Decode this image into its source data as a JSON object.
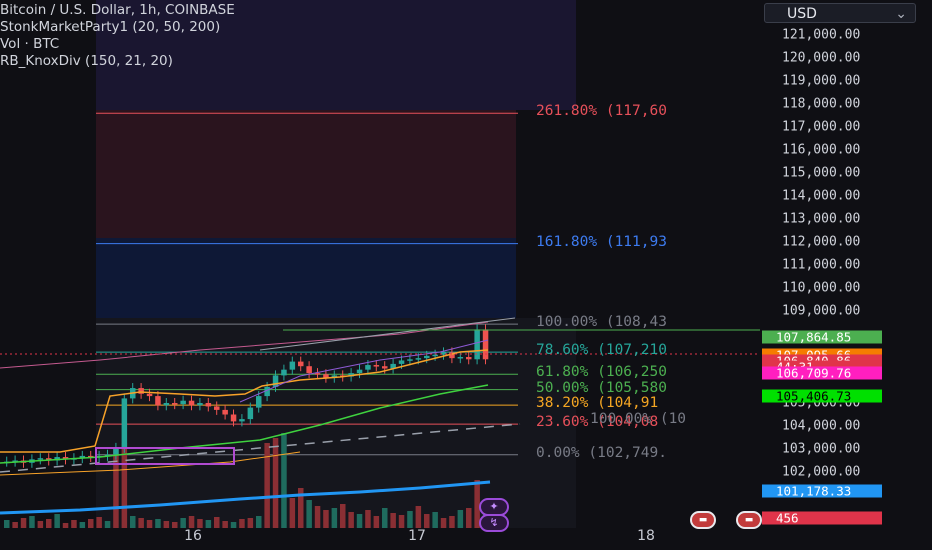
{
  "legend": {
    "symbol": "Bitcoin / U.S. Dollar, 1h, COINBASE",
    "indicator1": "StonkMarketParty1 (20, 50, 200)",
    "indicator2": "Vol · BTC",
    "indicator3": "RB_KnoxDiv (150, 21, 20)"
  },
  "currency": "USD",
  "price_axis": {
    "ticks": [
      "121,000.00",
      "120,000.00",
      "119,000.00",
      "118,000.00",
      "117,000.00",
      "116,000.00",
      "115,000.00",
      "114,000.00",
      "113,000.00",
      "112,000.00",
      "111,000.00",
      "110,000.00",
      "109,000.00",
      "105,000.00",
      "104,000.00",
      "103,000.00",
      "102,000.00",
      ".000.00"
    ],
    "tick_values": [
      121000,
      120000,
      119000,
      118000,
      117000,
      116000,
      115000,
      114000,
      113000,
      112000,
      111000,
      110000,
      109000,
      105000,
      104000,
      103000,
      102000,
      100000
    ]
  },
  "price_badges": [
    {
      "text": "107,864.85",
      "value": 107864.85,
      "bg": "#4caf50",
      "fg": "#ffffff"
    },
    {
      "text": "107,095.66",
      "value": 107095.66,
      "bg": "#f57c00",
      "fg": "#ffffff"
    },
    {
      "text": "106,840.86",
      "value": 106840.86,
      "bg": "#e0344a",
      "fg": "#ffffff"
    },
    {
      "text": "44:31",
      "value": 106560,
      "bg": "#e0344a",
      "fg": "#ffffff"
    },
    {
      "text": "106,709.76",
      "value": 106300,
      "bg": "#ff1fbf",
      "fg": "#ffffff"
    },
    {
      "text": "105,406.73",
      "value": 105300,
      "bg": "#00e000",
      "fg": "#000000"
    },
    {
      "text": "101,178.33",
      "value": 101178.33,
      "bg": "#2196f3",
      "fg": "#ffffff"
    },
    {
      "text": "456",
      "value": 100000,
      "bg": "#e0344a",
      "fg": "#ffffff"
    }
  ],
  "fib_levels": [
    {
      "label": "261.80% (117,60",
      "value": 117600,
      "color": "#e6505a"
    },
    {
      "label": "161.80% (111,93",
      "value": 111930,
      "color": "#3d7bf0"
    },
    {
      "label": "100.00% (108,43",
      "value": 108430,
      "color": "#787b86"
    },
    {
      "label": "78.60% (107,210",
      "value": 107210,
      "color": "#26a69a"
    },
    {
      "label": "61.80% (106,250",
      "value": 106250,
      "color": "#4caf50"
    },
    {
      "label": "50.00% (105,580",
      "value": 105580,
      "color": "#4caf50"
    },
    {
      "label": "38.20% (104,91",
      "value": 104910,
      "color": "#f5a623"
    },
    {
      "label": "23.60% (104,08",
      "value": 104080,
      "color": "#e6505a"
    },
    {
      "label": "0.00% (102,749.",
      "value": 102749,
      "color": "#787b86"
    }
  ],
  "fib_extra_label": "100.00% (10",
  "time_axis": [
    "16",
    "17",
    "18"
  ],
  "colors": {
    "up": "#26a69a",
    "down": "#ef5350",
    "ma_orange": "#f7a229",
    "ma_green": "#3fd23f",
    "ma_blue": "#2196f3",
    "ma_pink": "#c45a8f"
  }
}
